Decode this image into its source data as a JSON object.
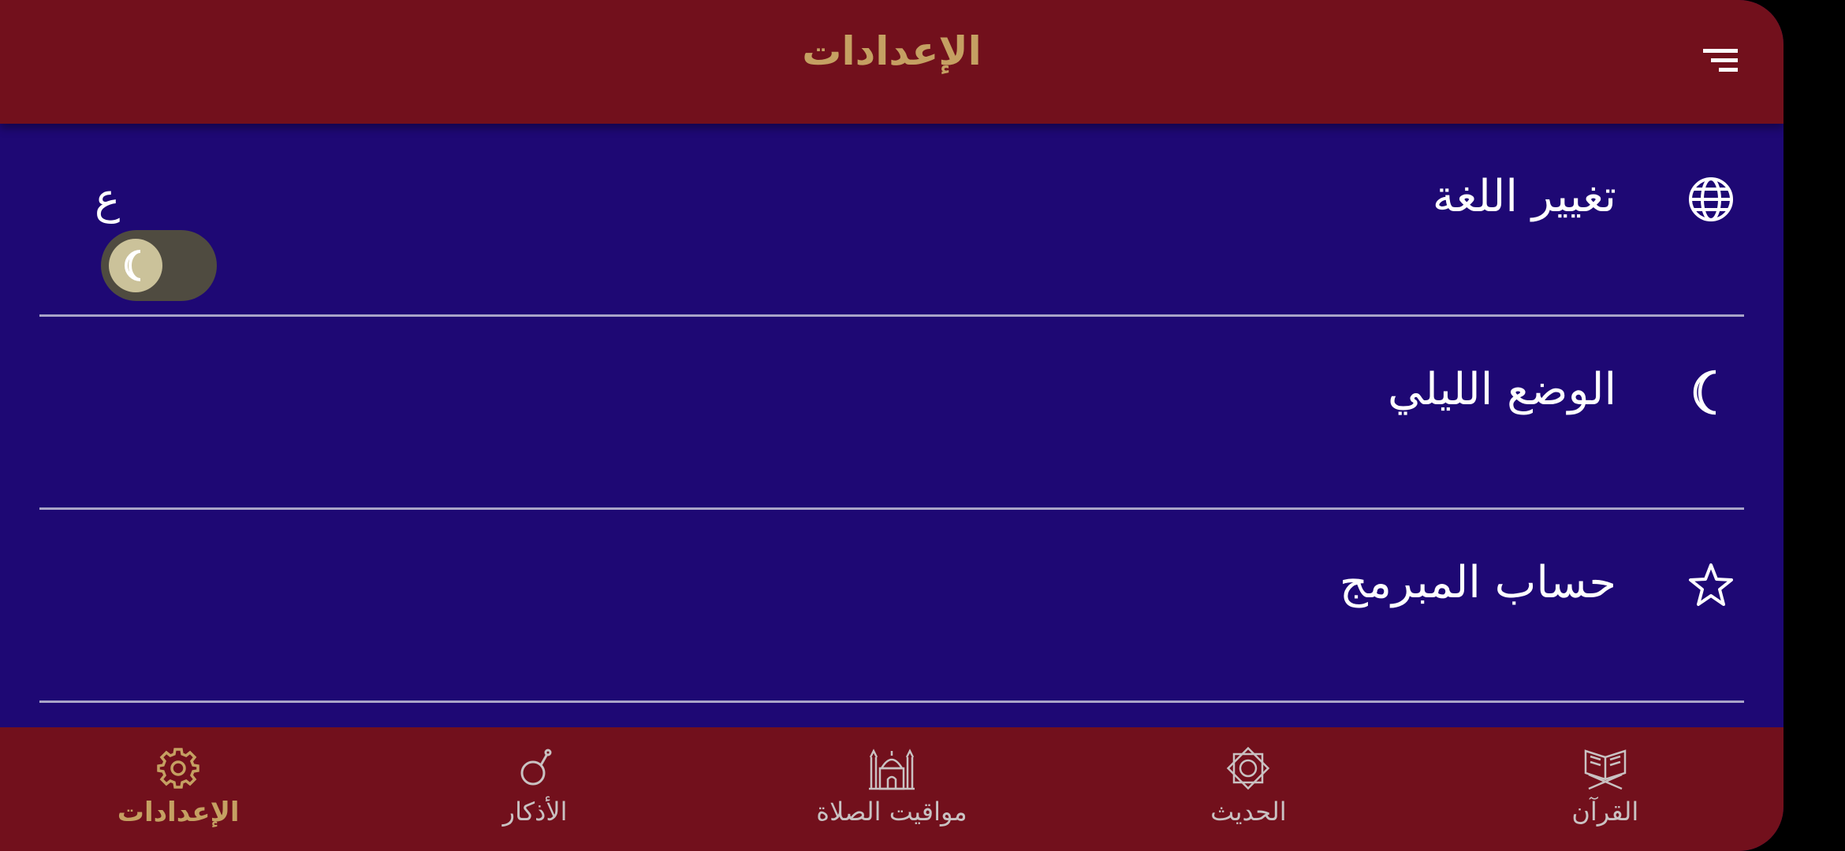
{
  "header": {
    "title": "الإعدادات",
    "menu_icon": "menu-icon"
  },
  "settings": [
    {
      "label": "تغيير اللغة",
      "icon": "globe-icon",
      "value": "ع"
    },
    {
      "label": "الوضع الليلي",
      "icon": "moon-icon",
      "toggle_on": false
    },
    {
      "label": "حساب المبرمج",
      "icon": "star-icon"
    }
  ],
  "bottom_nav": [
    {
      "label": "القرآن",
      "icon": "quran-icon",
      "active": false
    },
    {
      "label": "الحديث",
      "icon": "hadith-icon",
      "active": false
    },
    {
      "label": "مواقيت الصلاة",
      "icon": "mosque-icon",
      "active": false
    },
    {
      "label": "الأذكار",
      "icon": "prayer-beads-icon",
      "active": false
    },
    {
      "label": "الإعدادات",
      "icon": "gear-icon",
      "active": true
    }
  ],
  "colors": {
    "bar_background": "#72101c",
    "content_background": "#1e0874",
    "accent_gold": "#c5a062",
    "nav_inactive": "#c9c2c2"
  }
}
